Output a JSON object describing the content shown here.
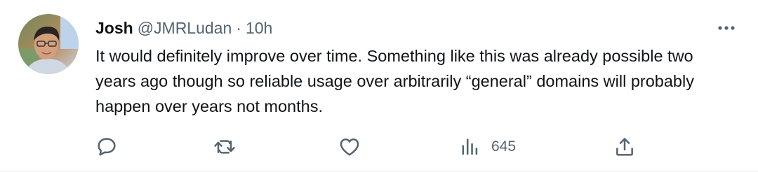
{
  "tweet": {
    "author_name": "Josh",
    "handle": "@JMRLudan",
    "separator": "·",
    "time": "10h",
    "text": "It would definitely improve over time. Something like this was already possible two years ago though so reliable usage over arbitrarily “general” domains will probably happen over years not months.",
    "views": "645"
  },
  "icons": {
    "more": "more-horizontal-icon",
    "reply": "reply-icon",
    "retweet": "retweet-icon",
    "like": "heart-icon",
    "views": "analytics-icon",
    "share": "share-icon"
  },
  "colors": {
    "text": "#0f1419",
    "secondary": "#536471"
  }
}
